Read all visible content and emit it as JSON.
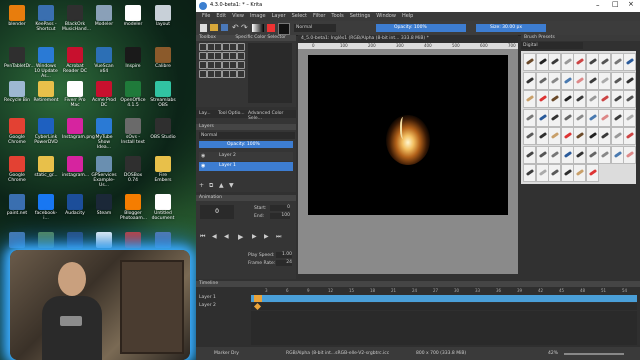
{
  "desktop": {
    "icons": [
      {
        "label": "blender",
        "color": "#e87d0d",
        "glyph": "blender-icon"
      },
      {
        "label": "KeePass - Shortcut",
        "color": "#3a6fb0",
        "glyph": "keepass-icon"
      },
      {
        "label": "BlackOrk MusicHand...",
        "color": "#2f2f2f",
        "glyph": "music-icon"
      },
      {
        "label": "Modeler",
        "color": "#8aa0b8",
        "glyph": "modeler-icon"
      },
      {
        "label": "modeler",
        "color": "#ffffff",
        "glyph": "modeler-icon"
      },
      {
        "label": "layout",
        "color": "#c8d0d8",
        "glyph": "layout-icon"
      },
      {
        "label": "PenTabletDr...",
        "color": "#2f2f2f",
        "glyph": "tablet-icon"
      },
      {
        "label": "Windows 10 Update As...",
        "color": "#2a7ad5",
        "glyph": "windows-icon"
      },
      {
        "label": "Acrobat Reader DC",
        "color": "#c8102e",
        "glyph": "acrobat-icon"
      },
      {
        "label": "VueScan x64",
        "color": "#2c6fb5",
        "glyph": "scanner-icon"
      },
      {
        "label": "Inspire",
        "color": "#1a1a1a",
        "glyph": "inspire-icon"
      },
      {
        "label": "Calibre",
        "color": "#8b5a2b",
        "glyph": "calibre-icon"
      },
      {
        "label": "Recycle Bin",
        "color": "#9db8d2",
        "glyph": "recycle-bin-icon"
      },
      {
        "label": "Retirement",
        "color": "#e8c04a",
        "glyph": "folder-icon"
      },
      {
        "label": "Fiverr Pro Mac",
        "color": "#ffffff",
        "glyph": "app-icon"
      },
      {
        "label": "Acme Prod DC",
        "color": "#c8102e",
        "glyph": "app-icon"
      },
      {
        "label": "OpenOffice 4.1.5",
        "color": "#1f7a3a",
        "glyph": "openoffice-icon"
      },
      {
        "label": "Streamlabs OBS",
        "color": "#31c3a2",
        "glyph": "streamlabs-icon"
      },
      {
        "label": "Google Chrome",
        "color": "#e34133",
        "glyph": "chrome-icon"
      },
      {
        "label": "CyberLink PowerDVD",
        "color": "#1e60c0",
        "glyph": "dvd-icon"
      },
      {
        "label": "Instagram.png",
        "color": "#d6249f",
        "glyph": "instagram-icon"
      },
      {
        "label": "MyTube Show Idea...",
        "color": "#2a7ad5",
        "glyph": "video-icon"
      },
      {
        "label": "sOvs - Install text",
        "color": "#6a6a6a",
        "glyph": "text-icon"
      },
      {
        "label": "OBS Studio",
        "color": "#2f2f2f",
        "glyph": "obs-icon"
      },
      {
        "label": "Google Chrome",
        "color": "#e34133",
        "glyph": "chrome-icon"
      },
      {
        "label": "static_gr...",
        "color": "#e8c04a",
        "glyph": "folder-icon"
      },
      {
        "label": "instagram...",
        "color": "#d6249f",
        "glyph": "instagram-icon"
      },
      {
        "label": "GPServices Example-Us...",
        "color": "#6a8fb0",
        "glyph": "app-icon"
      },
      {
        "label": "DOSBox 0.74",
        "color": "#2f2f2f",
        "glyph": "dosbox-icon"
      },
      {
        "label": "Fire Embers",
        "color": "#e8c04a",
        "glyph": "folder-icon"
      },
      {
        "label": "paint.net",
        "color": "#3a6fb0",
        "glyph": "paintnet-icon"
      },
      {
        "label": "facebook-i...",
        "color": "#1877f2",
        "glyph": "facebook-icon"
      },
      {
        "label": "Audacity",
        "color": "#1c4e9a",
        "glyph": "audacity-icon"
      },
      {
        "label": "Steam",
        "color": "#1b2838",
        "glyph": "steam-icon"
      },
      {
        "label": "Blogger Photoaam...",
        "color": "#f57d00",
        "glyph": "blogger-icon"
      },
      {
        "label": "Untitled document",
        "color": "#ffffff",
        "glyph": "document-icon"
      },
      {
        "label": "",
        "color": "#4a7ab0",
        "glyph": "app-icon"
      },
      {
        "label": "",
        "color": "#5a8a50",
        "glyph": "app-icon"
      },
      {
        "label": "",
        "color": "#2a4a7a",
        "glyph": "app-icon"
      },
      {
        "label": "",
        "color": "#ffffff",
        "glyph": "copyright-icon"
      },
      {
        "label": "",
        "color": "#d23a30",
        "glyph": "app-icon"
      },
      {
        "label": "",
        "color": "#5a7ab0",
        "glyph": "app-icon"
      }
    ]
  },
  "krita": {
    "title": "4.3.0-beta1: * – Krita",
    "menu": [
      "File",
      "Edit",
      "View",
      "Image",
      "Layer",
      "Select",
      "Filter",
      "Tools",
      "Settings",
      "Window",
      "Help"
    ],
    "toolbar": {
      "blend_mode": "Normal",
      "opacity": "Opacity: 100%",
      "size": "Size: 30.00 px"
    },
    "panels": {
      "toolbox": "Toolbox",
      "color_selector": "Specific Color Selector",
      "layers_tab": "Lay...",
      "tool_options_tab": "Tool Optio...",
      "advanced_color_tab": "Advanced Color Sele...",
      "layers_header": "Layers",
      "blend": "Normal",
      "opacity": "Opacity: 100%",
      "layer_items": [
        "Layer 2",
        "Layer 1"
      ],
      "animation": "Animation",
      "frame": "0",
      "start_label": "Start:",
      "start_val": "0",
      "end_label": "End:",
      "end_val": "100",
      "play_speed_label": "Play Speed:",
      "play_speed_val": "1.00",
      "frame_rate_label": "Frame Rate:",
      "frame_rate_val": "24",
      "brush_presets": "Brush Presets",
      "brush_tag": "Digital"
    },
    "document_tab": "4_5.0-beta1: Inglès1 (RGB/Alpha (8-bit int... 333.8 MiB) *",
    "ruler_ticks": [
      "0",
      "100",
      "200",
      "300",
      "400",
      "500",
      "600",
      "700"
    ],
    "timeline": {
      "header": "Timeline",
      "layers": [
        "Layer 1",
        "Layer 2"
      ],
      "frame_numbers": [
        "3",
        "6",
        "9",
        "12",
        "15",
        "18",
        "21",
        "24",
        "27",
        "30",
        "33",
        "36",
        "39",
        "42",
        "45",
        "48",
        "51",
        "54"
      ]
    },
    "status": {
      "left": "Marker Dry",
      "colorspace": "RGB/Alpha (8-bit int...sRGB-elle-V2-srgbtrc.icc",
      "dims": "800 x 700 (333.8 MiB)",
      "zoom": "42%"
    }
  },
  "taskbar": {
    "note": ""
  }
}
